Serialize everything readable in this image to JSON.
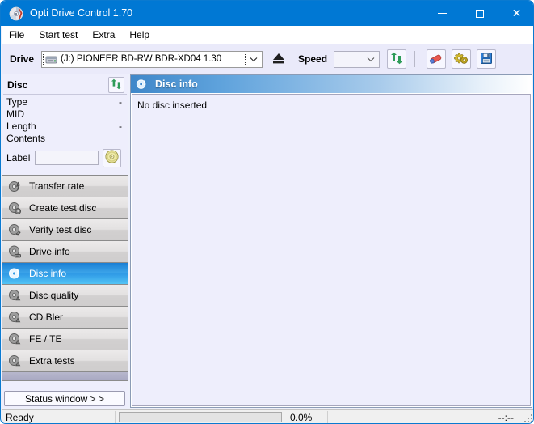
{
  "window": {
    "title": "Opti Drive Control 1.70",
    "app_icon": "cd-disc-icon",
    "minimize_label": "–",
    "maximize_label": "□",
    "close_label": "✕",
    "titlebar_color": "#0078d4"
  },
  "menubar": {
    "items": [
      {
        "label": "File"
      },
      {
        "label": "Start test"
      },
      {
        "label": "Extra"
      },
      {
        "label": "Help"
      }
    ]
  },
  "toolbar": {
    "drive_label": "Drive",
    "drive_value": "(J:)   PIONEER BD-RW   BDR-XD04 1.30",
    "drive_icon": "optical-drive-icon",
    "eject_icon": "eject-icon",
    "speed_label": "Speed",
    "speed_value": "",
    "refresh_icon": "refresh-icon",
    "eraser_icon": "eraser-icon",
    "gear_icon": "gears-icon",
    "save_icon": "floppy-save-icon"
  },
  "disc_panel": {
    "caption": "Disc",
    "refresh_icon": "refresh-icon",
    "rows": [
      {
        "name": "Type",
        "value": "-"
      },
      {
        "name": "MID",
        "value": ""
      },
      {
        "name": "Length",
        "value": "-"
      },
      {
        "name": "Contents",
        "value": ""
      }
    ],
    "label_field_label": "Label",
    "label_field_value": "",
    "label_button_icon": "cd-disc-gold-icon"
  },
  "sidebar": {
    "items": [
      {
        "label": "Transfer rate",
        "icon": "disc-transfer-icon",
        "selected": false
      },
      {
        "label": "Create test disc",
        "icon": "disc-create-icon",
        "selected": false
      },
      {
        "label": "Verify test disc",
        "icon": "disc-verify-icon",
        "selected": false
      },
      {
        "label": "Drive info",
        "icon": "disc-drive-icon",
        "selected": false
      },
      {
        "label": "Disc info",
        "icon": "disc-info-icon",
        "selected": true
      },
      {
        "label": "Disc quality",
        "icon": "disc-quality-icon",
        "selected": false
      },
      {
        "label": "CD Bler",
        "icon": "disc-bler-icon",
        "selected": false
      },
      {
        "label": "FE / TE",
        "icon": "disc-fete-icon",
        "selected": false
      },
      {
        "label": "Extra tests",
        "icon": "disc-extra-icon",
        "selected": false
      }
    ],
    "status_window_button": "Status window > >"
  },
  "main": {
    "panel_title": "Disc info",
    "panel_icon": "disc-info-icon",
    "message": "No disc inserted"
  },
  "statusbar": {
    "status_text": "Ready",
    "progress_percent": "0.0%",
    "progress_value": 0,
    "timer": "--:--"
  }
}
